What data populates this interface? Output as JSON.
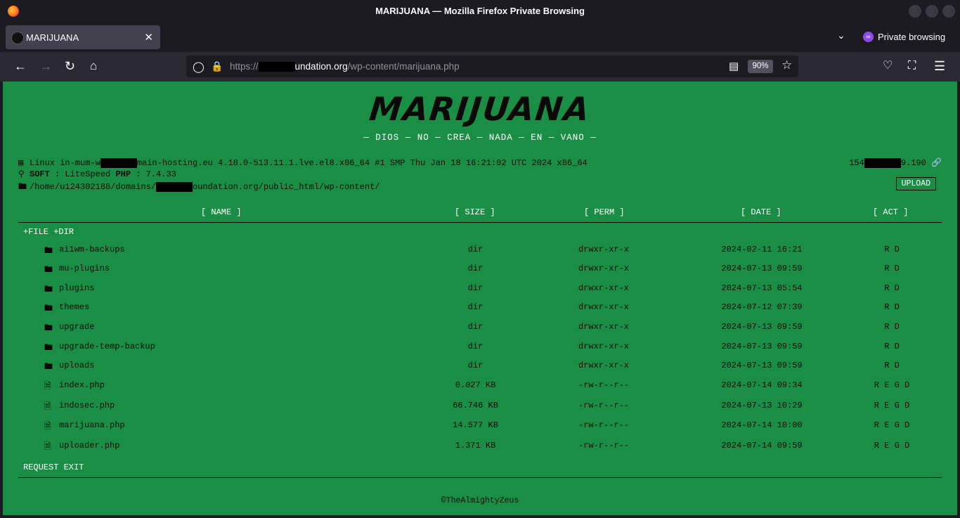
{
  "window": {
    "title": "MARIJUANA — Mozilla Firefox Private Browsing"
  },
  "tab": {
    "title": "MARIJUANA",
    "close": "✕"
  },
  "private": {
    "label": "Private browsing"
  },
  "navbar": {
    "url_prefix": "https://",
    "url_domain": "oundation.org",
    "url_domain_prefix": "undation.org",
    "url_path": "/wp-content/marijuana.php",
    "zoom": "90%"
  },
  "page": {
    "logo": "MARIJUANA",
    "slogan": "— DIOS — NO — CREA — NADA — EN — VANO —",
    "system": {
      "uname_a": "Linux in-mum-w",
      "uname_b": "main-hosting.eu 4.18.0-513.11.1.lve.el8.x86_64 #1 SMP Thu Jan 18 16:21:02 UTC 2024 x86_64",
      "soft_label": "SOFT",
      "soft_value": ": LiteSpeed",
      "php_label": "PHP",
      "php_value": ": 7.4.33",
      "path_a": "/home/u124302188/domains/",
      "path_b": "oundation.org/public_html/wp-content/",
      "ip_a": "154",
      "ip_b": "9.190"
    },
    "upload_label": "UPLOAD",
    "headers": {
      "name": "[ NAME ]",
      "size": "[ SIZE ]",
      "perm": "[ PERM ]",
      "date": "[ DATE ]",
      "act": "[ ACT ]"
    },
    "actions": "+FILE +DIR",
    "rows": [
      {
        "name": "ai1wm-backups",
        "size": "dir",
        "perm": "drwxr-xr-x",
        "date": "2024-02-11 16:21",
        "act": "R D",
        "type": "folder"
      },
      {
        "name": "mu-plugins",
        "size": "dir",
        "perm": "drwxr-xr-x",
        "date": "2024-07-13 09:59",
        "act": "R D",
        "type": "folder"
      },
      {
        "name": "plugins",
        "size": "dir",
        "perm": "drwxr-xr-x",
        "date": "2024-07-13 05:54",
        "act": "R D",
        "type": "folder"
      },
      {
        "name": "themes",
        "size": "dir",
        "perm": "drwxr-xr-x",
        "date": "2024-07-12 07:39",
        "act": "R D",
        "type": "folder"
      },
      {
        "name": "upgrade",
        "size": "dir",
        "perm": "drwxr-xr-x",
        "date": "2024-07-13 09:59",
        "act": "R D",
        "type": "folder"
      },
      {
        "name": "upgrade-temp-backup",
        "size": "dir",
        "perm": "drwxr-xr-x",
        "date": "2024-07-13 09:59",
        "act": "R D",
        "type": "folder"
      },
      {
        "name": "uploads",
        "size": "dir",
        "perm": "drwxr-xr-x",
        "date": "2024-07-13 09:59",
        "act": "R D",
        "type": "folder"
      },
      {
        "name": "index.php",
        "size": "0.027 KB",
        "perm": "-rw-r--r--",
        "date": "2024-07-14 09:34",
        "act": "R E G D",
        "type": "file"
      },
      {
        "name": "indosec.php",
        "size": "66.746 KB",
        "perm": "-rw-r--r--",
        "date": "2024-07-13 10:29",
        "act": "R E G D",
        "type": "file"
      },
      {
        "name": "marijuana.php",
        "size": "14.577 KB",
        "perm": "-rw-r--r--",
        "date": "2024-07-14 10:00",
        "act": "R E G D",
        "type": "file"
      },
      {
        "name": "uploader.php",
        "size": "1.371 KB",
        "perm": "-rw-r--r--",
        "date": "2024-07-14 09:59",
        "act": "R E G D",
        "type": "file"
      }
    ],
    "request_exit": "REQUEST EXIT",
    "footer": "©TheAlmightyZeus"
  }
}
